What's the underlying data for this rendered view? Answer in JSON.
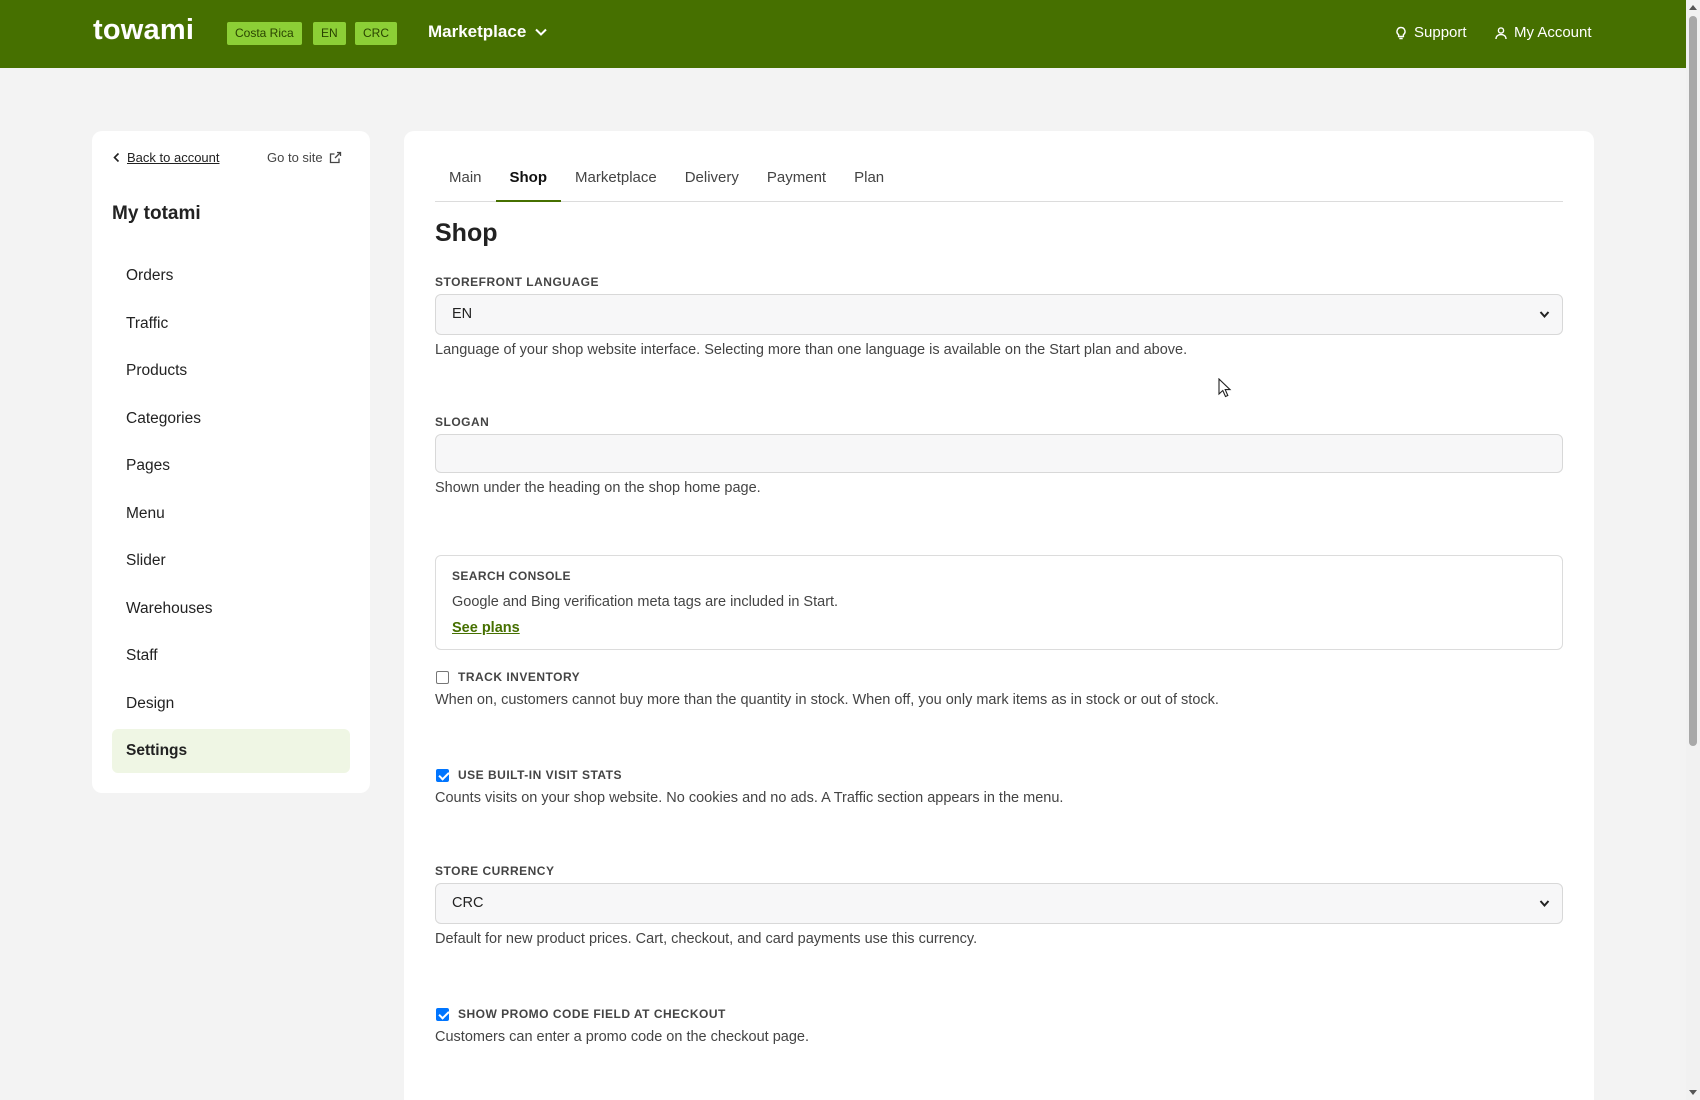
{
  "header": {
    "brand": "towami",
    "badges": [
      "Costa Rica",
      "EN",
      "CRC"
    ],
    "marketplace_label": "Marketplace",
    "support_label": "Support",
    "account_label": "My Account"
  },
  "sidebar": {
    "back_label": "Back to account",
    "goto_label": "Go to site",
    "title": "My totami",
    "items": [
      {
        "label": "Orders"
      },
      {
        "label": "Traffic"
      },
      {
        "label": "Products"
      },
      {
        "label": "Categories"
      },
      {
        "label": "Pages"
      },
      {
        "label": "Menu"
      },
      {
        "label": "Slider"
      },
      {
        "label": "Warehouses"
      },
      {
        "label": "Staff"
      },
      {
        "label": "Design"
      },
      {
        "label": "Settings"
      }
    ],
    "active_item": "Settings"
  },
  "main": {
    "tabs": [
      "Main",
      "Shop",
      "Marketplace",
      "Delivery",
      "Payment",
      "Plan"
    ],
    "active_tab": "Shop",
    "title": "Shop",
    "storefront_language": {
      "label": "STOREFRONT LANGUAGE",
      "value": "EN",
      "help": "Language of your shop website interface. Selecting more than one language is available on the Start plan and above."
    },
    "slogan": {
      "label": "SLOGAN",
      "value": "",
      "help": "Shown under the heading on the shop home page."
    },
    "search_console": {
      "title": "SEARCH CONSOLE",
      "text": "Google and Bing verification meta tags are included in Start.",
      "link": "See plans"
    },
    "track_inventory": {
      "label": "TRACK INVENTORY",
      "checked": false,
      "help": "When on, customers cannot buy more than the quantity in stock. When off, you only mark items as in stock or out of stock."
    },
    "visit_stats": {
      "label": "USE BUILT-IN VISIT STATS",
      "checked": true,
      "help": "Counts visits on your shop website. No cookies and no ads. A Traffic section appears in the menu."
    },
    "store_currency": {
      "label": "STORE CURRENCY",
      "value": "CRC",
      "help": "Default for new product prices. Cart, checkout, and card payments use this currency."
    },
    "promo_code": {
      "label": "SHOW PROMO CODE FIELD AT CHECKOUT",
      "checked": true,
      "help": "Customers can enter a promo code on the checkout page."
    }
  },
  "colors": {
    "brand_green": "#467000",
    "badge_green": "#8ccf36",
    "active_nav_bg": "#eff6e4",
    "checkbox_blue": "#0075ff"
  }
}
